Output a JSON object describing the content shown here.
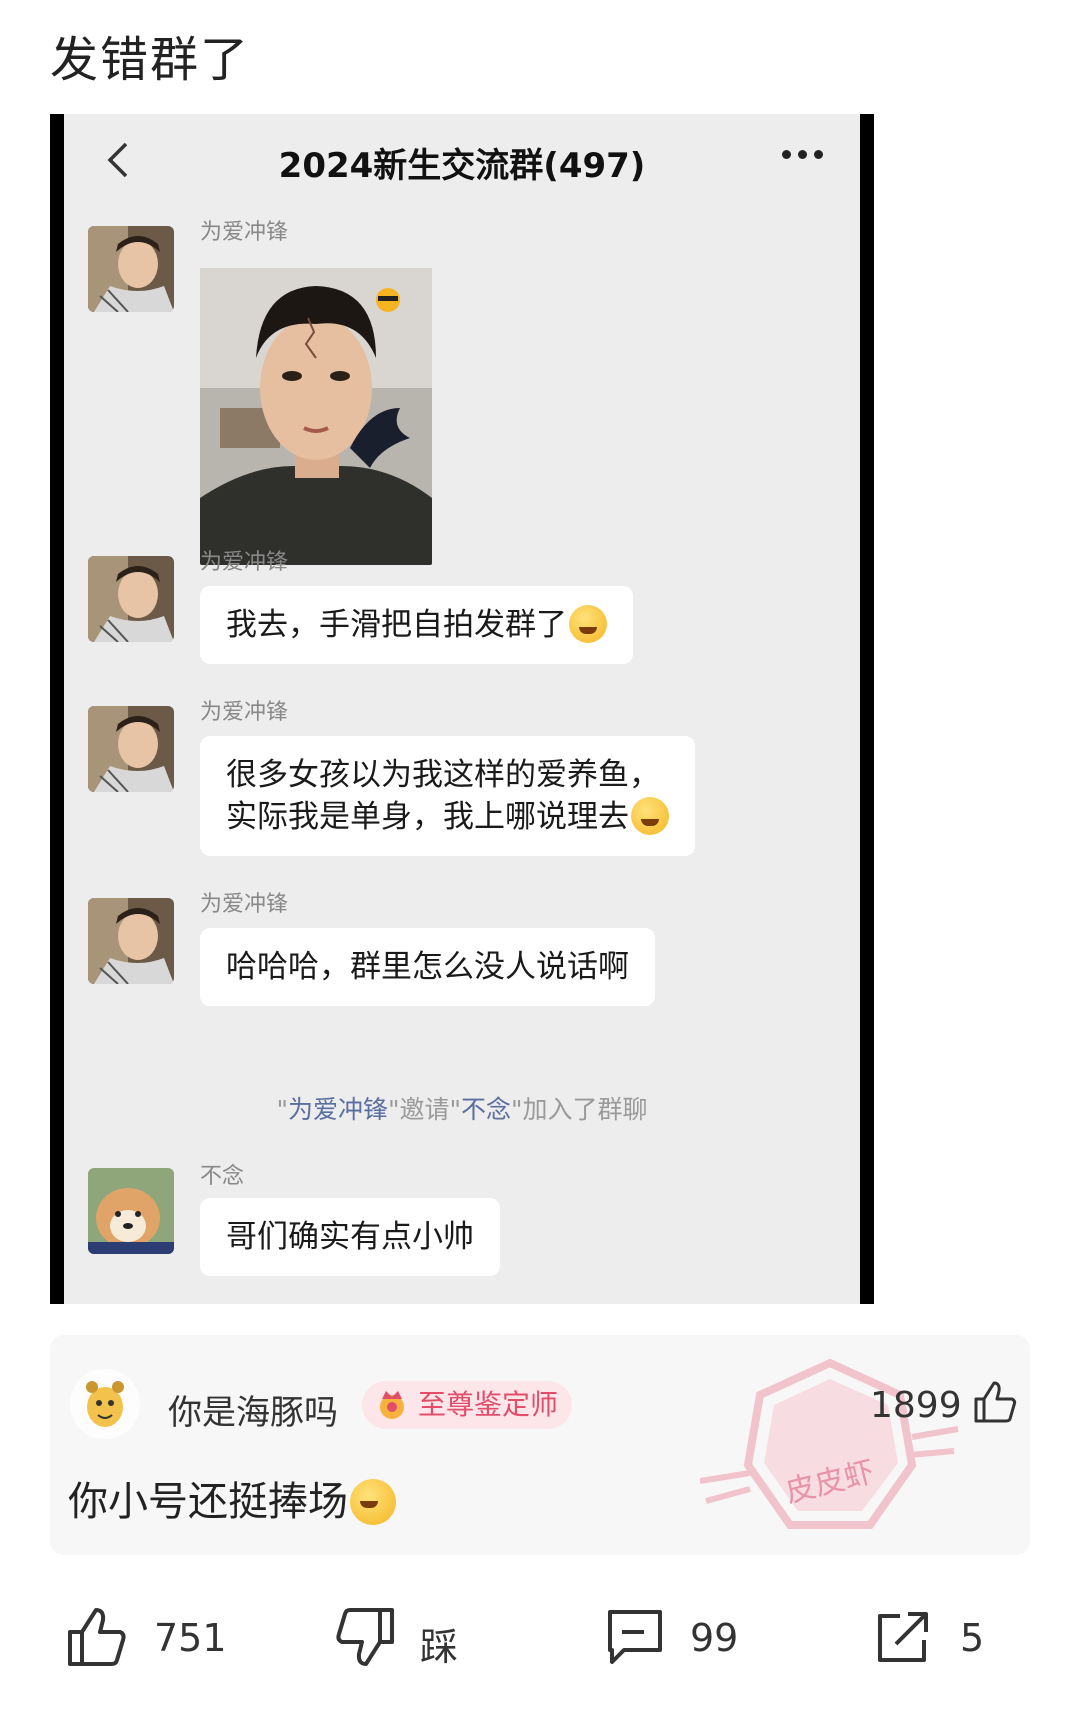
{
  "post": {
    "title": "发错群了"
  },
  "chat": {
    "title": "2024新生交流群(497)",
    "icons": {
      "back": "chevron-left-icon",
      "more": "more-dots-icon"
    },
    "messages": [
      {
        "sender": "为爱冲锋",
        "type": "image"
      },
      {
        "sender": "为爱冲锋",
        "text": "我去，手滑把自拍发群了",
        "emoji": "laughing-crying-emoji"
      },
      {
        "sender": "为爱冲锋",
        "lines": [
          "很多女孩以为我这样的爱养鱼，",
          "实际我是单身，我上哪说理去"
        ],
        "emoji": "weary-emoji"
      },
      {
        "sender": "为爱冲锋",
        "text": "哈哈哈，群里怎么没人说话啊"
      },
      {
        "sender": "不念",
        "text": "哥们确实有点小帅"
      }
    ],
    "system_note": {
      "q1": "\"",
      "inviter": "为爱冲锋",
      "mid": "\"邀请\"",
      "invitee": "不念",
      "tail": "\"加入了群聊"
    }
  },
  "comment": {
    "username": "你是海豚吗",
    "badge": "至尊鉴定师",
    "likes": "1899",
    "text": "你小号还挺捧场",
    "stamp_text": "皮皮虾"
  },
  "actions": {
    "like_count": "751",
    "dislike_label": "踩",
    "comment_count": "99",
    "share_count": "5"
  },
  "colors": {
    "badge_text": "#e24d6a",
    "badge_bg": "#fde6ea",
    "chat_bg": "#ededed",
    "note_name": "#5a6ea0"
  }
}
